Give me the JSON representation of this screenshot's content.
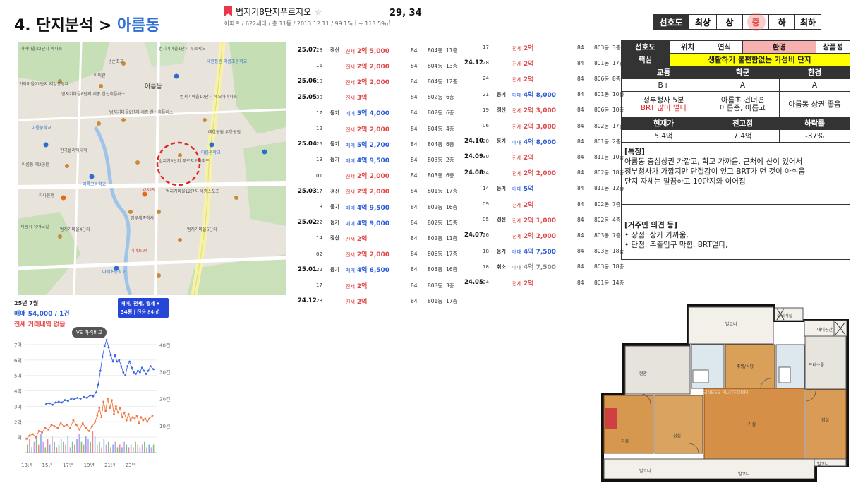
{
  "header": {
    "title_prefix": "4. 단지분석 > ",
    "title_area": "아름동",
    "complex_name": "범지기8단지푸르지오",
    "star": "☆",
    "complex_meta": "아파트 / 622세대 / 총 11동 / 2013.12.11 / 99.15㎡ ~ 113.59㎡",
    "coords": "29, 34"
  },
  "preference_bar": {
    "label": "선호도",
    "options": [
      "최상",
      "상",
      "중",
      "하",
      "최하"
    ],
    "selected": "중"
  },
  "map": {
    "labels": [
      "가락마을22단지 아파트",
      "범지기마을1단지 푸르지오",
      "생순초교",
      "아미관",
      "대한동원 아름초등학교",
      "범지기마을10단지 해오마아파트",
      "아름동",
      "가락마을21단지 제일풍경채",
      "범지기마을8단지 세종 한신휴플러스",
      "범지기마을9단지 세종 한신휴플러스",
      "아름중학교",
      "한국폴리텍대학",
      "아름동 제2공원",
      "아름동학교",
      "범지기8단지 푸르지오아파트",
      "아름고등학교",
      "대한동원 우웅동원",
      "GS25",
      "이마트24",
      "범지기마을12단지 세종스포츠",
      "세종시 유아교실",
      "정부세종청사",
      "하나은행",
      "범지기마을4단지",
      "나래초등학교",
      "범지기마을6단지"
    ]
  },
  "chart": {
    "period": "25년 7월",
    "sale_summary": "매매 54,000 / 1건",
    "jeonse_summary": "전세 거래내역 없음",
    "filter_line1": "매매, 전세, 월세 ▾",
    "filter_line2a": "34평",
    "filter_line2b": "| 전용 84㎡",
    "vs_button": "VS 가격비교"
  },
  "chart_data": {
    "type": "line",
    "x_ticks": [
      "13년",
      "15년",
      "17년",
      "19년",
      "21년",
      "23년"
    ],
    "x_range": [
      2013,
      2025.6
    ],
    "y_ticks_left": [
      "1억",
      "2억",
      "3억",
      "4억",
      "5억",
      "6억",
      "7억"
    ],
    "y_range_left": [
      0,
      7.5
    ],
    "y_ticks_right": [
      "10건",
      "20건",
      "30건",
      "40건"
    ],
    "y_range_right": [
      0,
      43
    ],
    "series": [
      {
        "name": "매매",
        "color": "#3a66e0",
        "points": [
          [
            2015.0,
            3.15
          ],
          [
            2015.3,
            3.2
          ],
          [
            2015.6,
            3.1
          ],
          [
            2015.9,
            3.25
          ],
          [
            2016.2,
            3.3
          ],
          [
            2016.5,
            3.25
          ],
          [
            2016.8,
            3.4
          ],
          [
            2017.1,
            3.35
          ],
          [
            2017.4,
            3.5
          ],
          [
            2017.7,
            3.45
          ],
          [
            2018.0,
            3.55
          ],
          [
            2018.3,
            3.5
          ],
          [
            2018.6,
            3.6
          ],
          [
            2018.9,
            3.55
          ],
          [
            2019.2,
            3.7
          ],
          [
            2019.5,
            3.65
          ],
          [
            2019.8,
            3.9
          ],
          [
            2020.0,
            4.4
          ],
          [
            2020.2,
            5.3
          ],
          [
            2020.4,
            6.2
          ],
          [
            2020.6,
            6.9
          ],
          [
            2020.8,
            7.3
          ],
          [
            2021.0,
            6.8
          ],
          [
            2021.2,
            6.3
          ],
          [
            2021.4,
            5.9
          ],
          [
            2021.6,
            6.3
          ],
          [
            2021.8,
            5.9
          ],
          [
            2022.0,
            6.0
          ],
          [
            2022.2,
            5.6
          ],
          [
            2022.4,
            5.2
          ],
          [
            2022.6,
            5.0
          ],
          [
            2022.8,
            5.6
          ],
          [
            2023.0,
            5.9
          ],
          [
            2023.2,
            5.5
          ],
          [
            2023.4,
            5.2
          ],
          [
            2023.6,
            5.1
          ],
          [
            2023.8,
            5.3
          ],
          [
            2024.0,
            5.2
          ],
          [
            2024.2,
            5.5
          ],
          [
            2024.4,
            5.3
          ],
          [
            2024.6,
            5.1
          ],
          [
            2024.8,
            5.3
          ],
          [
            2025.0,
            5.6
          ],
          [
            2025.3,
            5.4
          ]
        ]
      },
      {
        "name": "전세",
        "color": "#f07840",
        "points": [
          [
            2013.1,
            0.9
          ],
          [
            2013.4,
            1.1
          ],
          [
            2013.7,
            1.2
          ],
          [
            2014.0,
            1.0
          ],
          [
            2014.3,
            1.4
          ],
          [
            2014.6,
            1.3
          ],
          [
            2014.9,
            1.6
          ],
          [
            2015.2,
            1.5
          ],
          [
            2015.5,
            1.8
          ],
          [
            2015.8,
            1.7
          ],
          [
            2016.1,
            1.6
          ],
          [
            2016.4,
            1.9
          ],
          [
            2016.7,
            1.7
          ],
          [
            2017.0,
            1.8
          ],
          [
            2017.3,
            1.6
          ],
          [
            2017.6,
            2.1
          ],
          [
            2017.9,
            1.8
          ],
          [
            2018.2,
            1.5
          ],
          [
            2018.5,
            1.9
          ],
          [
            2018.8,
            1.6
          ],
          [
            2019.1,
            1.4
          ],
          [
            2019.4,
            1.7
          ],
          [
            2019.7,
            2.0
          ],
          [
            2019.9,
            2.4
          ],
          [
            2020.1,
            2.9
          ],
          [
            2020.3,
            2.3
          ],
          [
            2020.5,
            3.3
          ],
          [
            2020.7,
            2.7
          ],
          [
            2020.9,
            3.5
          ],
          [
            2021.1,
            2.9
          ],
          [
            2021.3,
            3.4
          ],
          [
            2021.5,
            2.5
          ],
          [
            2021.7,
            3.0
          ],
          [
            2021.9,
            2.6
          ],
          [
            2022.1,
            2.9
          ],
          [
            2022.3,
            2.3
          ],
          [
            2022.5,
            2.6
          ],
          [
            2022.7,
            2.1
          ],
          [
            2022.9,
            2.5
          ],
          [
            2023.1,
            2.1
          ],
          [
            2023.3,
            2.3
          ],
          [
            2023.5,
            2.2
          ],
          [
            2023.7,
            2.4
          ],
          [
            2023.9,
            1.9
          ],
          [
            2024.1,
            2.3
          ],
          [
            2024.3,
            2.1
          ],
          [
            2024.5,
            2.2
          ],
          [
            2024.7,
            2.0
          ],
          [
            2024.9,
            2.2
          ],
          [
            2025.2,
            2.4
          ]
        ]
      }
    ],
    "volume_bars": [
      3,
      5,
      2,
      4,
      6,
      3,
      7,
      4,
      2,
      5,
      3,
      6,
      4,
      2,
      3,
      5,
      4,
      3,
      6,
      2,
      4,
      3,
      5,
      7,
      4,
      3,
      6,
      5,
      4,
      8,
      6,
      3,
      4,
      2,
      5,
      3,
      4,
      2,
      3,
      4,
      2,
      3,
      2,
      4,
      3,
      2,
      3,
      2,
      4,
      3,
      2,
      3,
      4,
      2,
      3,
      2,
      3
    ]
  },
  "transactions_left": [
    {
      "date": "25.07",
      "day": "28",
      "tag": "갱신",
      "kind": "jeonse",
      "label": "전세",
      "price": "2억 5,000",
      "area": "84",
      "dong": "804동",
      "floor": "11층"
    },
    {
      "date": "",
      "day": "16",
      "tag": "",
      "kind": "jeonse",
      "label": "전세",
      "price": "2억 2,000",
      "area": "84",
      "dong": "804동",
      "floor": "13층"
    },
    {
      "date": "25.06",
      "day": "10",
      "tag": "",
      "kind": "jeonse",
      "label": "전세",
      "price": "2억 2,000",
      "area": "84",
      "dong": "804동",
      "floor": "12층"
    },
    {
      "date": "25.05",
      "day": "30",
      "tag": "",
      "kind": "jeonse",
      "label": "전세",
      "price": "3억",
      "area": "84",
      "dong": "802동",
      "floor": "6층"
    },
    {
      "date": "",
      "day": "17",
      "tag": "등기",
      "kind": "maemae",
      "label": "매매",
      "price": "5억 4,000",
      "area": "84",
      "dong": "802동",
      "floor": "6층"
    },
    {
      "date": "",
      "day": "12",
      "tag": "",
      "kind": "jeonse",
      "label": "전세",
      "price": "2억 2,000",
      "area": "84",
      "dong": "804동",
      "floor": "4층"
    },
    {
      "date": "25.04",
      "day": "25",
      "tag": "등기",
      "kind": "maemae",
      "label": "매매",
      "price": "5억 2,700",
      "area": "84",
      "dong": "804동",
      "floor": "6층"
    },
    {
      "date": "",
      "day": "19",
      "tag": "등기",
      "kind": "maemae",
      "label": "매매",
      "price": "4억 9,500",
      "area": "84",
      "dong": "803동",
      "floor": "2층"
    },
    {
      "date": "",
      "day": "01",
      "tag": "",
      "kind": "jeonse",
      "label": "전세",
      "price": "2억 2,000",
      "area": "84",
      "dong": "803동",
      "floor": "6층"
    },
    {
      "date": "25.03",
      "day": "17",
      "tag": "갱신",
      "kind": "jeonse",
      "label": "전세",
      "price": "2억 2,000",
      "area": "84",
      "dong": "801동",
      "floor": "17층"
    },
    {
      "date": "",
      "day": "13",
      "tag": "등기",
      "kind": "maemae",
      "label": "매매",
      "price": "4억 9,500",
      "area": "84",
      "dong": "802동",
      "floor": "16층"
    },
    {
      "date": "25.02",
      "day": "22",
      "tag": "등기",
      "kind": "maemae",
      "label": "매매",
      "price": "4억 9,000",
      "area": "84",
      "dong": "802동",
      "floor": "15층"
    },
    {
      "date": "",
      "day": "14",
      "tag": "갱신",
      "kind": "jeonse",
      "label": "전세",
      "price": "2억",
      "area": "84",
      "dong": "802동",
      "floor": "11층"
    },
    {
      "date": "",
      "day": "02",
      "tag": "",
      "kind": "jeonse",
      "label": "전세",
      "price": "2억 2,000",
      "area": "84",
      "dong": "806동",
      "floor": "17층"
    },
    {
      "date": "25.01",
      "day": "22",
      "tag": "등기",
      "kind": "maemae",
      "label": "매매",
      "price": "4억 6,500",
      "area": "84",
      "dong": "803동",
      "floor": "16층"
    },
    {
      "date": "",
      "day": "17",
      "tag": "",
      "kind": "jeonse",
      "label": "전세",
      "price": "2억",
      "area": "84",
      "dong": "803동",
      "floor": "3층"
    },
    {
      "date": "24.12",
      "day": "28",
      "tag": "",
      "kind": "jeonse",
      "label": "전세",
      "price": "2억",
      "area": "84",
      "dong": "801동",
      "floor": "17층"
    }
  ],
  "transactions_right": [
    {
      "date": "",
      "day": "17",
      "tag": "",
      "kind": "jeonse",
      "label": "전세",
      "price": "2억",
      "area": "84",
      "dong": "803동",
      "floor": "3층"
    },
    {
      "date": "24.12",
      "day": "28",
      "tag": "",
      "kind": "jeonse",
      "label": "전세",
      "price": "2억",
      "area": "84",
      "dong": "801동",
      "floor": "17층"
    },
    {
      "date": "",
      "day": "24",
      "tag": "",
      "kind": "jeonse",
      "label": "전세",
      "price": "2억",
      "area": "84",
      "dong": "806동",
      "floor": "8층"
    },
    {
      "date": "",
      "day": "21",
      "tag": "등기",
      "kind": "maemae",
      "label": "매매",
      "price": "4억 8,000",
      "area": "84",
      "dong": "801동",
      "floor": "10층"
    },
    {
      "date": "",
      "day": "19",
      "tag": "갱신",
      "kind": "jeonse",
      "label": "전세",
      "price": "2억 3,000",
      "area": "84",
      "dong": "806동",
      "floor": "10층"
    },
    {
      "date": "",
      "day": "06",
      "tag": "",
      "kind": "jeonse",
      "label": "전세",
      "price": "2억 3,000",
      "area": "84",
      "dong": "802동",
      "floor": "17층"
    },
    {
      "date": "24.10",
      "day": "20",
      "tag": "등기",
      "kind": "maemae",
      "label": "매매",
      "price": "4억 8,000",
      "area": "84",
      "dong": "801동",
      "floor": "2층"
    },
    {
      "date": "24.09",
      "day": "30",
      "tag": "",
      "kind": "jeonse",
      "label": "전세",
      "price": "2억",
      "area": "84",
      "dong": "811동",
      "floor": "10층"
    },
    {
      "date": "24.08",
      "day": "24",
      "tag": "",
      "kind": "jeonse",
      "label": "전세",
      "price": "2억 2,000",
      "area": "84",
      "dong": "802동",
      "floor": "18층"
    },
    {
      "date": "",
      "day": "14",
      "tag": "등기",
      "kind": "maemae",
      "label": "매매",
      "price": "5억",
      "area": "84",
      "dong": "811동",
      "floor": "12층"
    },
    {
      "date": "",
      "day": "09",
      "tag": "",
      "kind": "jeonse",
      "label": "전세",
      "price": "2억",
      "area": "84",
      "dong": "802동",
      "floor": "7층"
    },
    {
      "date": "",
      "day": "05",
      "tag": "갱신",
      "kind": "jeonse",
      "label": "전세",
      "price": "2억 1,000",
      "area": "84",
      "dong": "802동",
      "floor": "4층"
    },
    {
      "date": "24.07",
      "day": "26",
      "tag": "",
      "kind": "jeonse",
      "label": "전세",
      "price": "2억 2,000",
      "area": "84",
      "dong": "803동",
      "floor": "7층"
    },
    {
      "date": "",
      "day": "18",
      "tag": "등기",
      "kind": "maemae",
      "label": "매매",
      "price": "4억 7,500",
      "area": "84",
      "dong": "803동",
      "floor": "18층"
    },
    {
      "date": "",
      "day": "18",
      "tag": "취소",
      "kind": "cancel",
      "label": "매매",
      "price": "4억 7,500",
      "area": "84",
      "dong": "803동",
      "floor": "18층"
    },
    {
      "date": "24.05",
      "day": "24",
      "tag": "",
      "kind": "jeonse",
      "label": "전세",
      "price": "2억",
      "area": "84",
      "dong": "801동",
      "floor": "14층"
    }
  ],
  "analysis": {
    "head": [
      "선호도",
      "위치",
      "연식",
      "환경",
      "상품성"
    ],
    "core_label": "핵심",
    "core_text": "생활하기 불편함없는 가성비 단지",
    "cat_head": [
      "교통",
      "학군",
      "환경"
    ],
    "grades": [
      "B+",
      "A",
      "A"
    ],
    "traffic_note_1": "정부청사 5분",
    "traffic_note_2": "BRT 많이 멀다",
    "school_note_1": "아름초 건너편",
    "school_note_2": "아름중, 아름고",
    "env_note": "아름동 상권 좋음",
    "price_head": [
      "현재가",
      "전고점",
      "하락률"
    ],
    "prices": [
      "5.4억",
      "7.4억",
      "-37%"
    ],
    "features_title": "[특징]",
    "features_1": "아름동 충심상권 가깝고, 학교 가까움. 근처에 산이 있어서",
    "features_2": "정부청사가 가깝지만 단절감이 있고 BRT가 먼 것이 아쉬움",
    "features_3": "단지 자체는 깔끔하고 10단지와 이어짐",
    "opinion_title": "[거주민 의견 등]",
    "opinion_1": "• 장점: 상가 가까움,",
    "opinion_2": "• 단점: 주출입구 막힘, BRT멀다,"
  },
  "floorplan": {
    "rooms": [
      "발코니",
      "실외기실",
      "대피공간",
      "드레스룸",
      "주방/식당",
      "거실",
      "침실",
      "침실",
      "침실",
      "발코니",
      "발코니",
      "발코니",
      "현관"
    ],
    "watermark": "BUSINESS PLATFORM"
  }
}
